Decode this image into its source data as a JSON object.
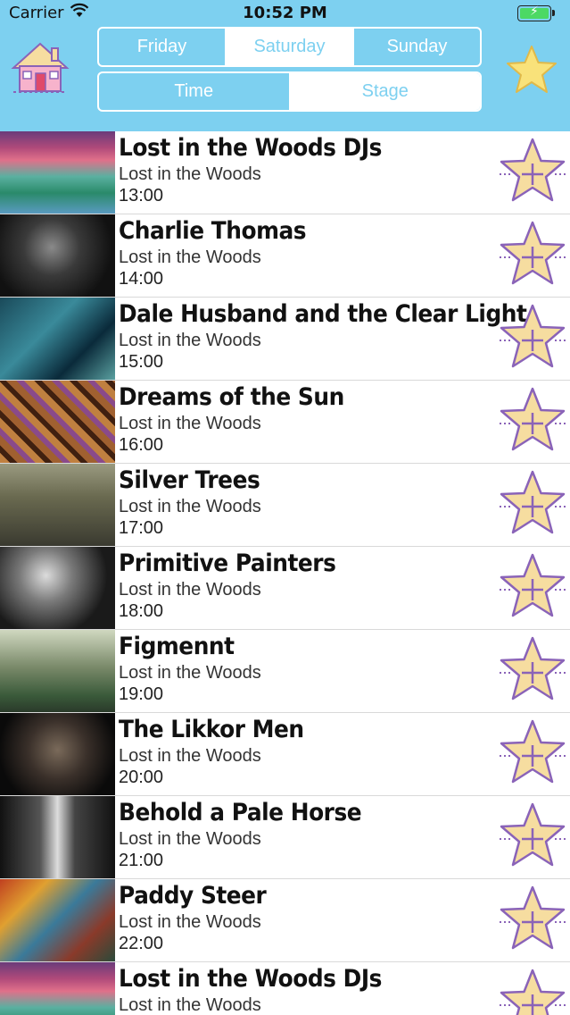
{
  "status_bar": {
    "carrier": "Carrier",
    "time": "10:52 PM"
  },
  "header": {
    "home_icon": "house-icon",
    "favorites_icon": "star-icon",
    "days": [
      {
        "label": "Friday",
        "selected": false
      },
      {
        "label": "Saturday",
        "selected": true
      },
      {
        "label": "Sunday",
        "selected": false
      }
    ],
    "sort_modes": [
      {
        "label": "Time",
        "selected": false
      },
      {
        "label": "Stage",
        "selected": true
      }
    ]
  },
  "colors": {
    "header_bg": "#7dd0f0",
    "star_fill": "#f6dda0",
    "star_stroke": "#8a63b8"
  },
  "schedule": [
    {
      "artist": "Lost in the Woods DJs",
      "stage": "Lost in the Woods",
      "time": "13:00",
      "thumb": "psychedelic-art"
    },
    {
      "artist": "Charlie Thomas",
      "stage": "Lost in the Woods",
      "time": "14:00",
      "thumb": "guitarist-photo"
    },
    {
      "artist": "Dale Husband and the Clear Light",
      "stage": "Lost in the Woods",
      "time": "15:00",
      "thumb": "studio-photo"
    },
    {
      "artist": "Dreams of the Sun",
      "stage": "Lost in the Woods",
      "time": "16:00",
      "thumb": "poster-art"
    },
    {
      "artist": "Silver Trees",
      "stage": "Lost in the Woods",
      "time": "17:00",
      "thumb": "band-photo"
    },
    {
      "artist": "Primitive Painters",
      "stage": "Lost in the Woods",
      "time": "18:00",
      "thumb": "live-bw-photo"
    },
    {
      "artist": "Figmennt",
      "stage": "Lost in the Woods",
      "time": "19:00",
      "thumb": "forest-photo"
    },
    {
      "artist": "The Likkor Men",
      "stage": "Lost in the Woods",
      "time": "20:00",
      "thumb": "band-photo-dark"
    },
    {
      "artist": "Behold a Pale Horse",
      "stage": "Lost in the Woods",
      "time": "21:00",
      "thumb": "stage-bw-photo"
    },
    {
      "artist": "Paddy Steer",
      "stage": "Lost in the Woods",
      "time": "22:00",
      "thumb": "colorful-room-photo"
    },
    {
      "artist": "Lost in the Woods DJs",
      "stage": "Lost in the Woods",
      "time": "",
      "thumb": "psychedelic-art"
    }
  ]
}
